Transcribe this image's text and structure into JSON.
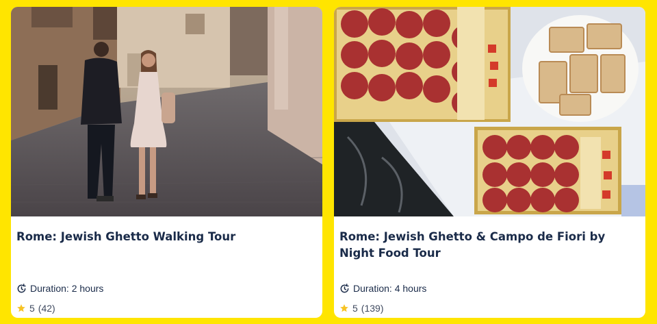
{
  "cards": [
    {
      "title": "Rome: Jewish Ghetto Walking Tour",
      "duration": "Duration: 2 hours",
      "rating": "5",
      "review_count": "(42)",
      "image_subject": "couple walking down a cobblestone street in Rome"
    },
    {
      "title": "Rome: Jewish Ghetto & Campo de Fiori by Night Food Tour",
      "duration": "Duration: 4 hours",
      "rating": "5",
      "review_count": "(139)",
      "image_subject": "platters of salami, cheese and bread"
    }
  ],
  "colors": {
    "background": "#FFE500",
    "title": "#1a2b49",
    "star": "#F7C325"
  },
  "icons": {
    "duration": "clock-refresh-icon",
    "rating": "star-icon"
  }
}
